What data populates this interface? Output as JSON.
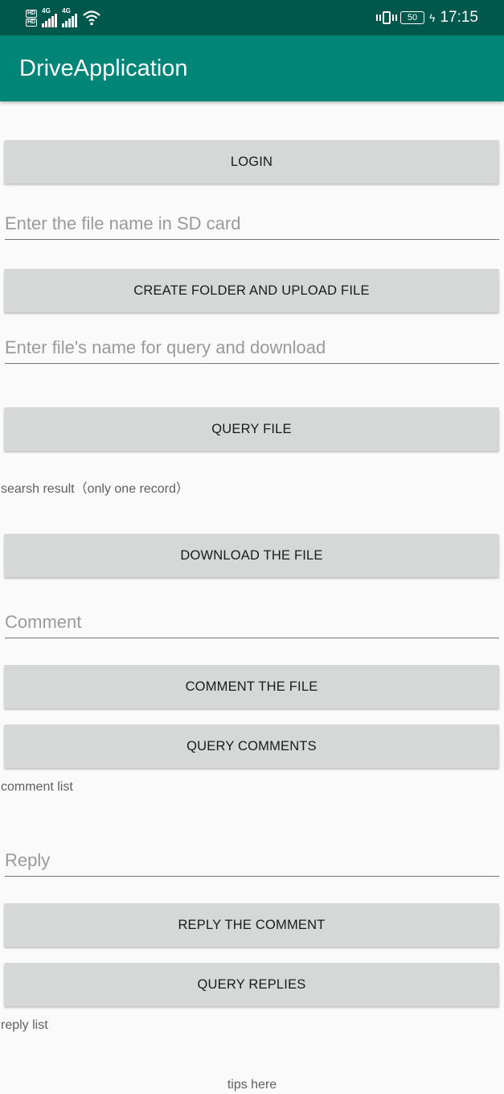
{
  "status_bar": {
    "network_1": "4G",
    "network_2": "4G",
    "hd_label": "HD",
    "battery_level": "50",
    "time": "17:15"
  },
  "app_bar": {
    "title": "DriveApplication"
  },
  "main": {
    "login_button": "LOGIN",
    "sd_file_input_placeholder": "Enter the file name in SD card",
    "create_upload_button": "CREATE FOLDER AND UPLOAD FILE",
    "query_name_input_placeholder": "Enter file's name for query and download",
    "query_file_button": "QUERY FILE",
    "search_result_text": "searsh result（only one record）",
    "download_button": "DOWNLOAD THE FILE",
    "comment_input_placeholder": "Comment",
    "comment_button": "COMMENT THE FILE",
    "query_comments_button": "QUERY COMMENTS",
    "comment_list_text": "comment list",
    "reply_input_placeholder": "Reply",
    "reply_button": "REPLY THE COMMENT",
    "query_replies_button": "QUERY REPLIES",
    "reply_list_text": "reply list",
    "tips_text": "tips here"
  }
}
